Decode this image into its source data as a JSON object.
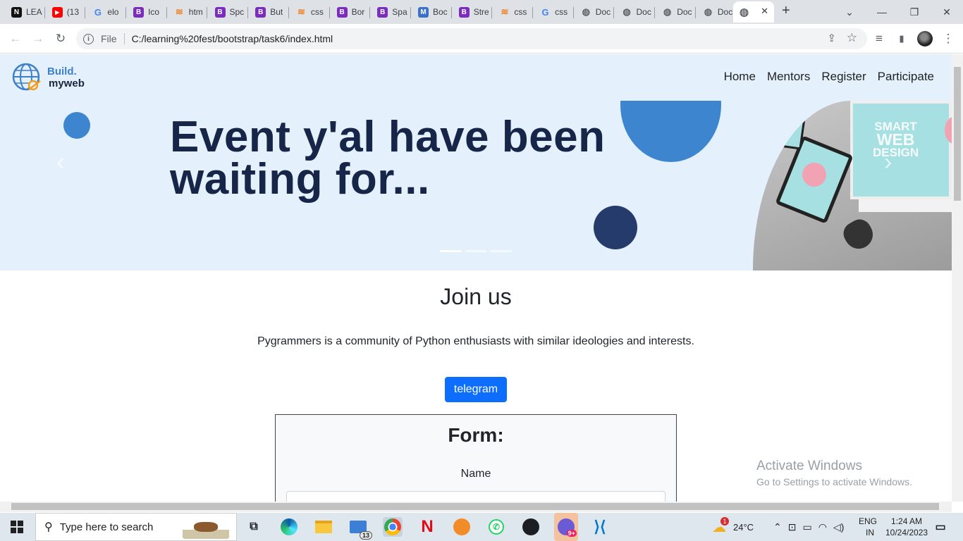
{
  "browser": {
    "tabs": [
      {
        "label": "LEA",
        "icon": "notion-icon",
        "color": "#111111",
        "glyph": "N"
      },
      {
        "label": "(13",
        "icon": "youtube-icon",
        "color": "#ff0000",
        "glyph": "▶"
      },
      {
        "label": "elo",
        "icon": "google-icon",
        "color": "#4285f4",
        "glyph": "G"
      },
      {
        "label": "Ico",
        "icon": "bootstrap-icon",
        "color": "#7b2cbf",
        "glyph": "B"
      },
      {
        "label": "htm",
        "icon": "stackoverflow-icon",
        "color": "#f48024",
        "glyph": "≋"
      },
      {
        "label": "Spc",
        "icon": "bootstrap-icon",
        "color": "#7b2cbf",
        "glyph": "B"
      },
      {
        "label": "But",
        "icon": "bootstrap-icon",
        "color": "#7b2cbf",
        "glyph": "B"
      },
      {
        "label": "css",
        "icon": "stackoverflow-icon",
        "color": "#f48024",
        "glyph": "≋"
      },
      {
        "label": "Bor",
        "icon": "bootstrap-icon",
        "color": "#7b2cbf",
        "glyph": "B"
      },
      {
        "label": "Spa",
        "icon": "bootstrap-icon",
        "color": "#7b2cbf",
        "glyph": "B"
      },
      {
        "label": "Boc",
        "icon": "mdb-icon",
        "color": "#3b71ca",
        "glyph": "M"
      },
      {
        "label": "Stre",
        "icon": "bootstrap-icon",
        "color": "#7b2cbf",
        "glyph": "B"
      },
      {
        "label": "css",
        "icon": "stackoverflow-icon",
        "color": "#f48024",
        "glyph": "≋"
      },
      {
        "label": "css",
        "icon": "google-icon",
        "color": "#4285f4",
        "glyph": "G"
      },
      {
        "label": "Doc",
        "icon": "globe-icon",
        "color": "#5f6368",
        "glyph": "◍"
      },
      {
        "label": "Doc",
        "icon": "globe-icon",
        "color": "#5f6368",
        "glyph": "◍"
      },
      {
        "label": "Doc",
        "icon": "globe-icon",
        "color": "#5f6368",
        "glyph": "◍"
      },
      {
        "label": "Doc",
        "icon": "globe-icon",
        "color": "#5f6368",
        "glyph": "◍"
      }
    ],
    "active_tab": {
      "icon": "globe-icon",
      "close_glyph": "✕"
    },
    "new_tab_glyph": "+",
    "window_controls": {
      "dropdown": "⌄",
      "minimize": "—",
      "restore": "❐",
      "close": "✕"
    },
    "nav": {
      "back": "←",
      "forward": "→",
      "reload": "↻"
    },
    "address": {
      "scheme_label": "File",
      "url": "C:/learning%20fest/bootstrap/task6/index.html"
    },
    "toolbar_icons": {
      "share": "⇪",
      "bookmark": "☆",
      "media": "≡",
      "sidepanel": "▮",
      "menu": "⋮"
    }
  },
  "site": {
    "brand": {
      "line1": "Build.",
      "line2": "myweb"
    },
    "nav": [
      "Home",
      "Mentors",
      "Register",
      "Participate"
    ],
    "hero": {
      "heading": "Event y'al have been waiting for...",
      "prev_glyph": "‹",
      "next_glyph": "›",
      "slide_count": 3,
      "mockup": {
        "line1": "SMART",
        "line2": "WEB",
        "line3": "DESIGN"
      }
    },
    "join": {
      "title": "Join us",
      "description": "Pygrammers is a community of Python enthusiasts with similar ideologies and interests.",
      "button": "telegram"
    },
    "form": {
      "title": "Form:",
      "name_label": "Name"
    }
  },
  "watermark": {
    "line1": "Activate Windows",
    "line2": "Go to Settings to activate Windows."
  },
  "taskbar": {
    "search_placeholder": "Type here to search",
    "mail_badge": "13",
    "copilot_badge": "9+",
    "weather": "24°C",
    "weather_badge": "1",
    "lang1": "ENG",
    "lang2": "IN",
    "time": "1:24 AM",
    "date": "10/24/2023"
  },
  "colors": {
    "accent": "#0d6efd",
    "hero_bg": "#e4f1fd",
    "heading": "#172548",
    "circle_light": "#3d85cf",
    "circle_dark": "#243b6b"
  }
}
